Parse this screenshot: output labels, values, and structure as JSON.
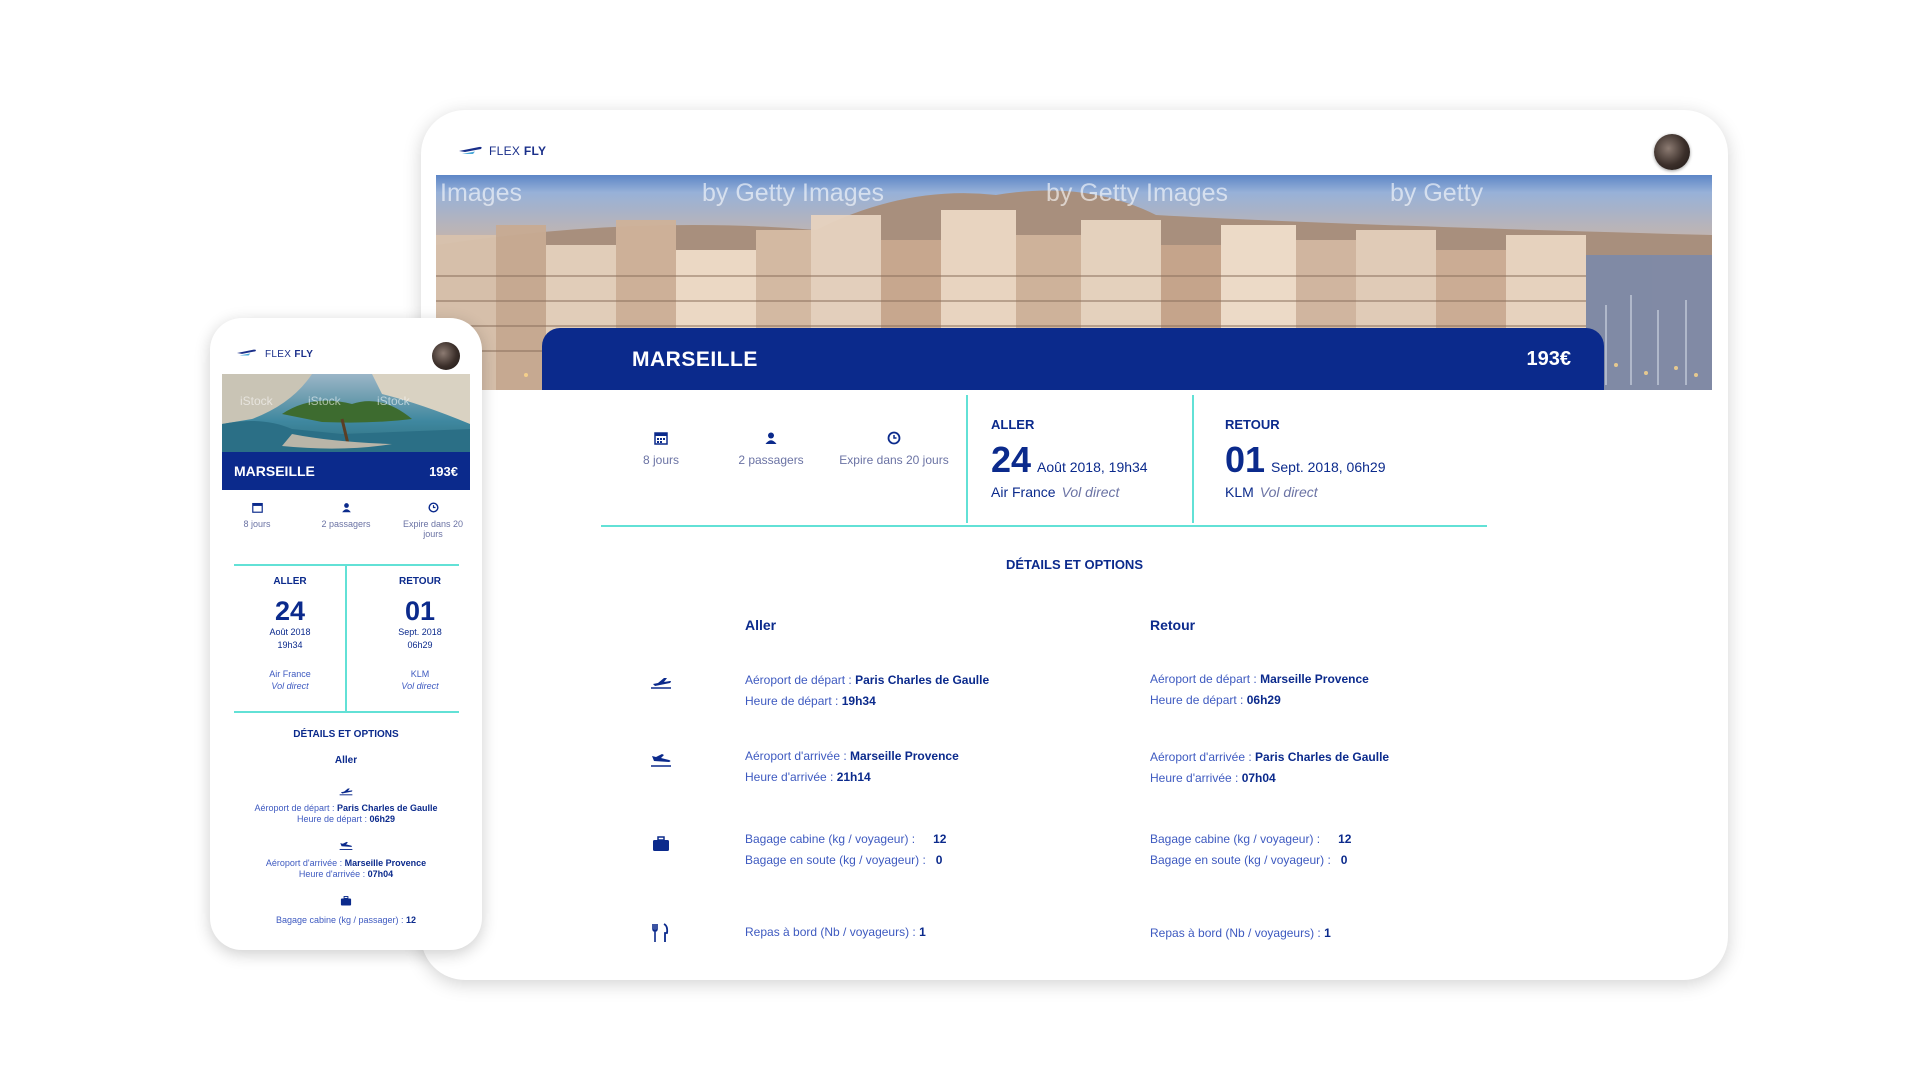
{
  "brand": {
    "name_light": "FLEX",
    "name_bold": "FLY",
    "color": "#0b2a8c",
    "accent": "#62e1d6"
  },
  "watermarks": [
    "Images",
    "by Getty Images",
    "by Getty Images",
    "by Getty"
  ],
  "mobile_watermarks": [
    "iStock",
    "iStock",
    "iStock"
  ],
  "destination": {
    "city": "MARSEILLE",
    "price": "193€"
  },
  "stats": {
    "duration": "8 jours",
    "passengers": "2 passagers",
    "expiry": "Expire dans 20 jours"
  },
  "aller": {
    "label": "ALLER",
    "day": "24",
    "when": "Août 2018, 19h34",
    "airline": "Air France",
    "type": "Vol direct",
    "m_month": "Août 2018",
    "m_time": "19h34"
  },
  "retour": {
    "label": "RETOUR",
    "day": "01",
    "when": "Sept. 2018, 06h29",
    "airline": "KLM",
    "type": "Vol direct",
    "m_month": "Sept. 2018",
    "m_time": "06h29"
  },
  "details": {
    "title": "DÉTAILS ET OPTIONS",
    "col_aller": "Aller",
    "col_retour": "Retour",
    "dep_airport_label": "Aéroport de départ :",
    "dep_time_label": "Heure de départ :",
    "arr_airport_label": "Aéroport d'arrivée :",
    "arr_time_label": "Heure d'arrivée :",
    "bag_cabin_label": "Bagage cabine (kg / voyageur) :",
    "bag_hold_label": "Bagage en soute (kg / voyageur) :",
    "meal_label": "Repas à bord (Nb / voyageurs) :",
    "aller": {
      "dep_airport": "Paris Charles de Gaulle",
      "dep_time": "19h34",
      "arr_airport": "Marseille Provence",
      "arr_time": "21h14",
      "bag_cabin": "12",
      "bag_hold": "0",
      "meal": "1"
    },
    "retour": {
      "dep_airport": "Marseille Provence",
      "dep_time": "06h29",
      "arr_airport": "Paris Charles de Gaulle",
      "arr_time": "07h04",
      "bag_cabin": "12",
      "bag_hold": "0",
      "meal": "1"
    }
  },
  "mobile_details": {
    "dep_airport": "Paris Charles de Gaulle",
    "dep_time": "06h29",
    "arr_airport": "Marseille Provence",
    "arr_time": "07h04",
    "bag_cabin_label": "Bagage cabine (kg / passager) :",
    "bag_cabin": "12"
  }
}
